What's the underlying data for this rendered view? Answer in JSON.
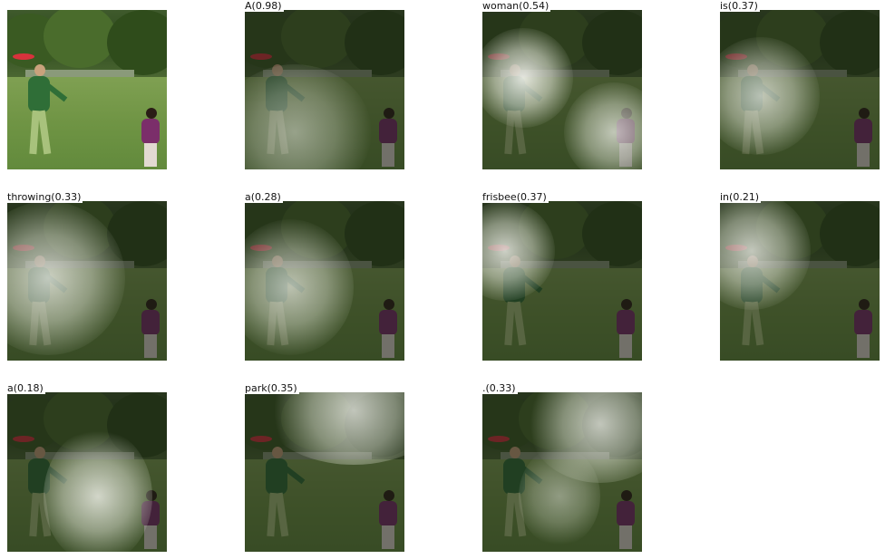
{
  "panels": [
    {
      "label": "",
      "attention": "none"
    },
    {
      "label": "A(0.98)",
      "attention": "lower-left"
    },
    {
      "label": "woman(0.54)",
      "attention": "woman-and-right"
    },
    {
      "label": "is(0.37)",
      "attention": "left-upper"
    },
    {
      "label": "throwing(0.33)",
      "attention": "left-wide"
    },
    {
      "label": "a(0.28)",
      "attention": "left-center"
    },
    {
      "label": "frisbee(0.37)",
      "attention": "frisbee"
    },
    {
      "label": "in(0.21)",
      "attention": "top-left"
    },
    {
      "label": "a(0.18)",
      "attention": "center"
    },
    {
      "label": "park(0.35)",
      "attention": "background"
    },
    {
      "label": ".(0.33)",
      "attention": "background-right"
    }
  ]
}
